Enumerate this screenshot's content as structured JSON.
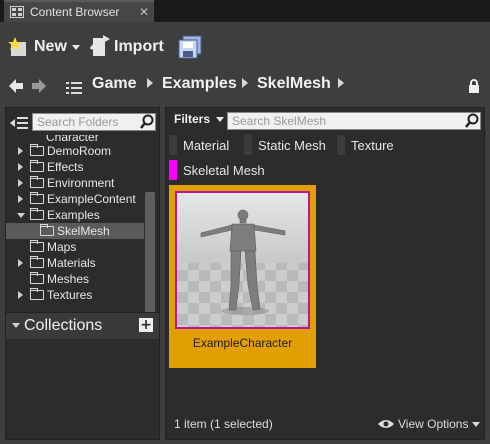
{
  "tab": {
    "title": "Content Browser",
    "close": "✕",
    "icon": "content-browser-icon"
  },
  "toolbar": {
    "new_label": "New",
    "import_label": "Import",
    "save_icon": "save-all-icon"
  },
  "path": {
    "crumbs": [
      "Game",
      "Examples",
      "SkelMesh"
    ],
    "lock_icon": "lock-icon"
  },
  "sources": {
    "search_placeholder": "Search Folders",
    "partial_top": "Character",
    "items": [
      {
        "label": "DemoRoom",
        "state": "closed"
      },
      {
        "label": "Effects",
        "state": "closed"
      },
      {
        "label": "Environment",
        "state": "closed"
      },
      {
        "label": "ExampleContent",
        "state": "closed"
      },
      {
        "label": "Examples",
        "state": "open"
      },
      {
        "label": "SkelMesh",
        "state": "none",
        "selected": true
      },
      {
        "label": "Maps",
        "state": "none"
      },
      {
        "label": "Materials",
        "state": "closed"
      },
      {
        "label": "Meshes",
        "state": "none"
      },
      {
        "label": "Textures",
        "state": "closed"
      }
    ]
  },
  "collections": {
    "title": "Collections",
    "add": "+"
  },
  "assets": {
    "filters_label": "Filters",
    "search_placeholder": "Search SkelMesh",
    "filter_chips": [
      {
        "label": "Material",
        "color": "#3b3b3b"
      },
      {
        "label": "Static Mesh",
        "color": "#3b3b3b"
      },
      {
        "label": "Texture",
        "color": "#3b3b3b"
      },
      {
        "label": "Skeletal Mesh",
        "color": "#ff00ff"
      }
    ],
    "items": [
      {
        "name": "ExampleCharacter"
      }
    ],
    "status": "1 item (1 selected)",
    "view_options": "View Options"
  },
  "colors": {
    "selected_tile": "#e29f04",
    "thumb_border": "#b7169e",
    "panel": "#3e3e3e",
    "inner": "#2c2c2c"
  }
}
